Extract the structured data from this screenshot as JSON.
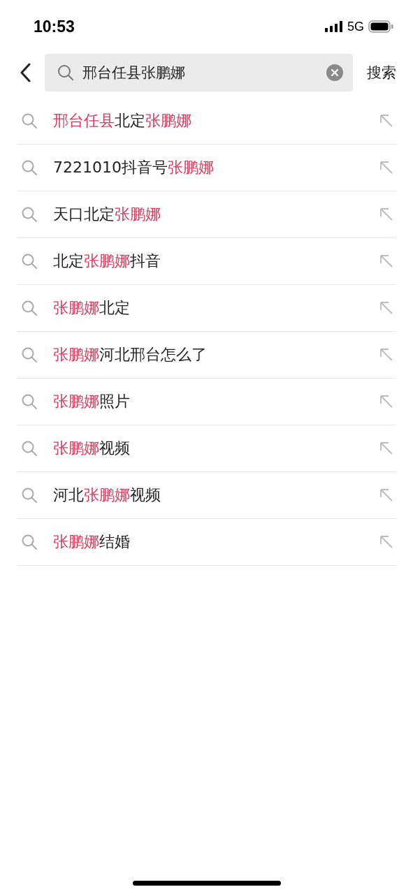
{
  "status_bar": {
    "time": "10:53",
    "network": "5G"
  },
  "search": {
    "value": "邢台任县张鹏娜",
    "button": "搜索"
  },
  "suggestions": [
    {
      "segments": [
        {
          "text": "邢台任县",
          "highlight": true
        },
        {
          "text": "北定",
          "highlight": false
        },
        {
          "text": "张鹏娜",
          "highlight": true
        }
      ]
    },
    {
      "segments": [
        {
          "text": "7221010抖音号",
          "highlight": false
        },
        {
          "text": "张鹏娜",
          "highlight": true
        }
      ]
    },
    {
      "segments": [
        {
          "text": "天口北定",
          "highlight": false
        },
        {
          "text": "张鹏娜",
          "highlight": true
        }
      ]
    },
    {
      "segments": [
        {
          "text": "北定",
          "highlight": false
        },
        {
          "text": "张鹏娜",
          "highlight": true
        },
        {
          "text": "抖音",
          "highlight": false
        }
      ]
    },
    {
      "segments": [
        {
          "text": "张鹏娜",
          "highlight": true
        },
        {
          "text": "北定",
          "highlight": false
        }
      ]
    },
    {
      "segments": [
        {
          "text": "张鹏娜",
          "highlight": true
        },
        {
          "text": "河北邢台怎么了",
          "highlight": false
        }
      ]
    },
    {
      "segments": [
        {
          "text": "张鹏娜",
          "highlight": true
        },
        {
          "text": "照片",
          "highlight": false
        }
      ]
    },
    {
      "segments": [
        {
          "text": "张鹏娜",
          "highlight": true
        },
        {
          "text": "视频",
          "highlight": false
        }
      ]
    },
    {
      "segments": [
        {
          "text": "河北",
          "highlight": false
        },
        {
          "text": "张鹏娜",
          "highlight": true
        },
        {
          "text": "视频",
          "highlight": false
        }
      ]
    },
    {
      "segments": [
        {
          "text": "张鹏娜",
          "highlight": true
        },
        {
          "text": "结婚",
          "highlight": false
        }
      ]
    }
  ]
}
